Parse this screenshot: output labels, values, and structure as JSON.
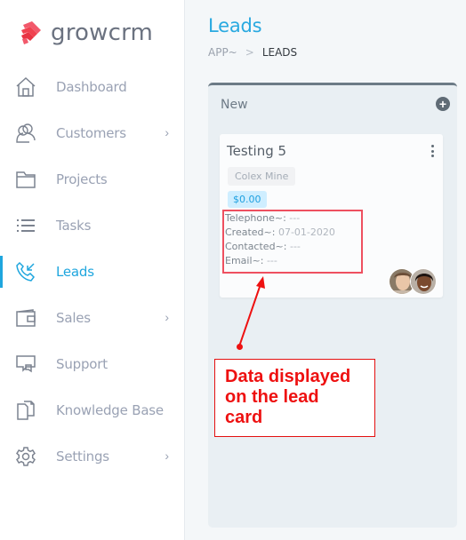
{
  "app": {
    "name": "growcrm"
  },
  "sidebar": {
    "items": [
      {
        "label": "Dashboard",
        "icon": "home-icon",
        "has_submenu": false,
        "active": false
      },
      {
        "label": "Customers",
        "icon": "users-icon",
        "has_submenu": true,
        "active": false
      },
      {
        "label": "Projects",
        "icon": "folder-icon",
        "has_submenu": false,
        "active": false
      },
      {
        "label": "Tasks",
        "icon": "list-icon",
        "has_submenu": false,
        "active": false
      },
      {
        "label": "Leads",
        "icon": "phone-incoming-icon",
        "has_submenu": false,
        "active": true
      },
      {
        "label": "Sales",
        "icon": "wallet-icon",
        "has_submenu": true,
        "active": false
      },
      {
        "label": "Support",
        "icon": "chat-bubbles-icon",
        "has_submenu": false,
        "active": false
      },
      {
        "label": "Knowledge Base",
        "icon": "documents-icon",
        "has_submenu": false,
        "active": false
      },
      {
        "label": "Settings",
        "icon": "gear-icon",
        "has_submenu": true,
        "active": false
      }
    ],
    "chevron": "›"
  },
  "header": {
    "title": "Leads",
    "breadcrumb": {
      "root": "APP~",
      "separator": ">",
      "current": "LEADS"
    }
  },
  "board": {
    "columns": [
      {
        "title": "New",
        "add_icon": "+",
        "cards": [
          {
            "title": "Testing 5",
            "company": "Colex Mine",
            "value": "$0.00",
            "fields": [
              {
                "label": "Telephone~:",
                "value": "---"
              },
              {
                "label": "Created~:",
                "value": "07-01-2020"
              },
              {
                "label": "Contacted~:",
                "value": "---"
              },
              {
                "label": "Email~:",
                "value": "---"
              }
            ],
            "assigned_avatars": 2
          }
        ]
      }
    ]
  },
  "annotation": {
    "text_lines": [
      "Data displayed",
      "on the lead",
      "card"
    ],
    "color": "#ee1111"
  },
  "colors": {
    "accent": "#1fa6de",
    "column_border": "#6c7b86",
    "value_tag_bg": "#cfeeff"
  }
}
